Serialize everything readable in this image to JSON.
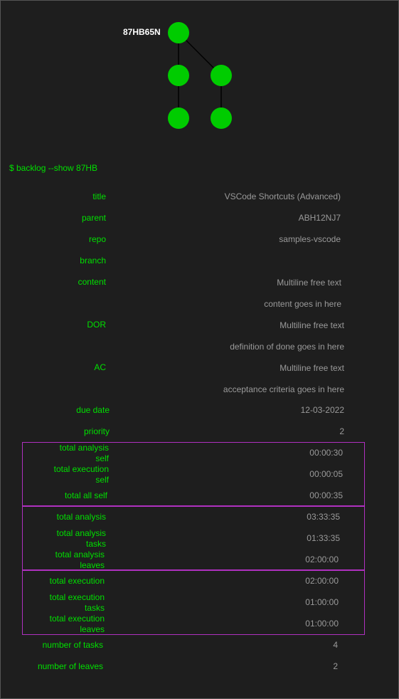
{
  "tree": {
    "root_label": "87HB65N",
    "node_color": "#00cc00"
  },
  "command": "$ backlog --show 87HB",
  "fields": [
    {
      "label": "title",
      "value": "VSCode Shortcuts (Advanced)"
    },
    {
      "label": "parent",
      "value": "ABH12NJ7"
    },
    {
      "label": "repo",
      "value": "samples-vscode"
    },
    {
      "label": "branch",
      "value": ""
    },
    {
      "label": "content",
      "value": "Multiline free text",
      "value2": "content goes in here"
    },
    {
      "label": "DOR",
      "value": "Multiline free text",
      "value2": "definition of done goes in here"
    },
    {
      "label": "AC",
      "value": "Multiline free text",
      "value2": "acceptance criteria goes in here"
    },
    {
      "label": "due date",
      "value": "12-03-2022"
    },
    {
      "label": "priority",
      "value": "2"
    }
  ],
  "self_block": [
    {
      "label1": "total analysis",
      "label2": "self",
      "value": "00:00:30"
    },
    {
      "label1": "total execution",
      "label2": "self",
      "value": "00:00:05"
    },
    {
      "label1": "total all self",
      "value": "00:00:35"
    }
  ],
  "analysis_block": [
    {
      "label1": "total analysis",
      "value": "03:33:35"
    },
    {
      "label1": "total analysis",
      "label2": "tasks",
      "value": "01:33:35"
    },
    {
      "label1": "total analysis",
      "label2": "leaves",
      "value": "02:00:00"
    }
  ],
  "execution_block": [
    {
      "label1": "total execution",
      "value": "02:00:00"
    },
    {
      "label1": "total execution",
      "label2": "tasks",
      "value": "01:00:00"
    },
    {
      "label1": "total execution",
      "label2": "leaves",
      "value": "01:00:00"
    }
  ],
  "counts": [
    {
      "label": "number of tasks",
      "value": "4"
    },
    {
      "label": "number of leaves",
      "value": "2"
    }
  ],
  "colors": {
    "background": "#1e1e1e",
    "label": "#00e000",
    "value": "#9a9a9a",
    "box_border": "#b030c0"
  }
}
